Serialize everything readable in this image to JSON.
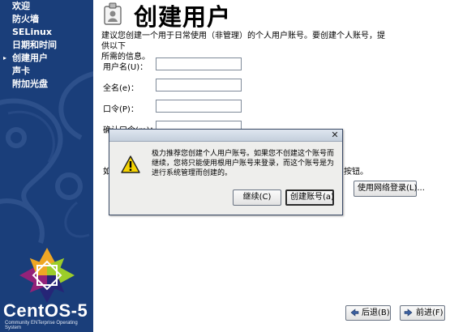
{
  "sidebar": {
    "items": [
      {
        "label": "欢迎",
        "active": false
      },
      {
        "label": "防火墙",
        "active": false
      },
      {
        "label": "SELinux",
        "active": false
      },
      {
        "label": "日期和时间",
        "active": false
      },
      {
        "label": "创建用户",
        "active": true
      },
      {
        "label": "声卡",
        "active": false
      },
      {
        "label": "附加光盘",
        "active": false
      }
    ],
    "active_marker": "▸",
    "brand_name": "CentOS-5",
    "brand_tagline": "Community ENTerprise Operating System",
    "background_color": "#1a3e7a"
  },
  "page": {
    "title": "创建用户",
    "title_icon": "user-badge-icon",
    "intro_line1": "建议您创建一个用于日常使用（非管理）的个人用户账号。要创建个人账号，提供以下",
    "intro_line2": "所需的信息。"
  },
  "form": {
    "username_label": "用户名(U)：",
    "username_value": "",
    "fullname_label": "全名(e)：",
    "fullname_value": "",
    "password_label": "口令(P)：",
    "password_value": "",
    "confirm_label": "确认口令(m)：",
    "confirm_value": ""
  },
  "behind": {
    "left_fragment": "如",
    "right_fragment": "按钮。"
  },
  "network_login_button": "使用网络登录(L)...",
  "nav_buttons": {
    "back": "后退(B)",
    "forward": "前进(F)"
  },
  "dialog": {
    "icon": "warning-icon",
    "message_line1": "极力推荐您创建个人用户账号。如果您不创建这个账号而",
    "message_line2": "继续，您将只能使用根用户账号来登录，而这个账号是为",
    "message_line3": "进行系统管理而创建的。",
    "continue_label": "继续(C)",
    "create_label": "创建账号(a)",
    "close_glyph": "✕"
  }
}
